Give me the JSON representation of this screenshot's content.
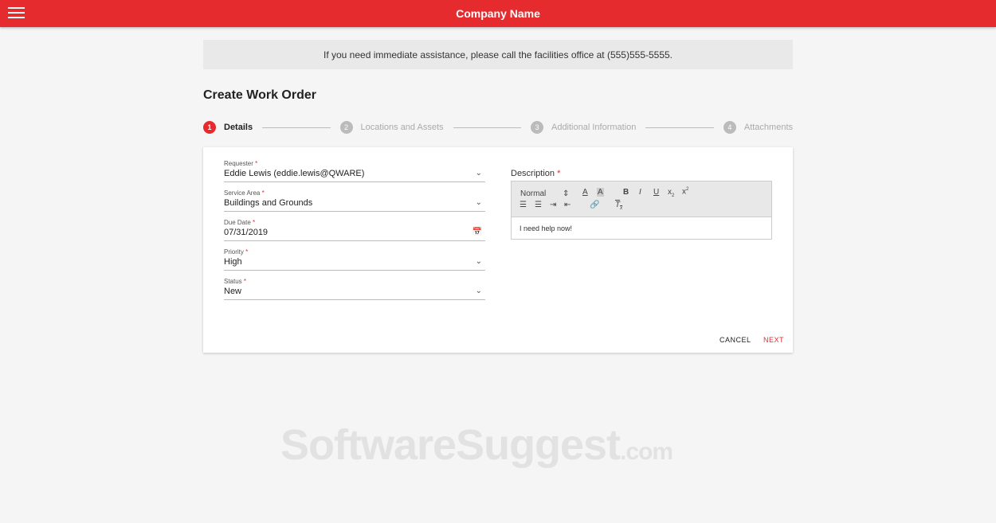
{
  "header": {
    "title": "Company Name"
  },
  "notice": "If you need immediate assistance, please call the facilities office at (555)555-5555.",
  "page_title": "Create Work Order",
  "steps": [
    {
      "num": "1",
      "label": "Details"
    },
    {
      "num": "2",
      "label": "Locations and Assets"
    },
    {
      "num": "3",
      "label": "Additional Information"
    },
    {
      "num": "4",
      "label": "Attachments"
    }
  ],
  "form": {
    "requester": {
      "label": "Requester",
      "value": "Eddie Lewis (eddie.lewis@QWARE)"
    },
    "service_area": {
      "label": "Service Area",
      "value": "Buildings and Grounds"
    },
    "due_date": {
      "label": "Due Date",
      "value": "07/31/2019"
    },
    "priority": {
      "label": "Priority",
      "value": "High"
    },
    "status": {
      "label": "Status",
      "value": "New"
    },
    "required_mark": "*"
  },
  "description": {
    "label": "Description",
    "format": "Normal",
    "content": "I need help now!"
  },
  "actions": {
    "cancel": "CANCEL",
    "next": "NEXT"
  },
  "watermark": {
    "main": "SoftwareSuggest",
    "suffix": ".com"
  }
}
